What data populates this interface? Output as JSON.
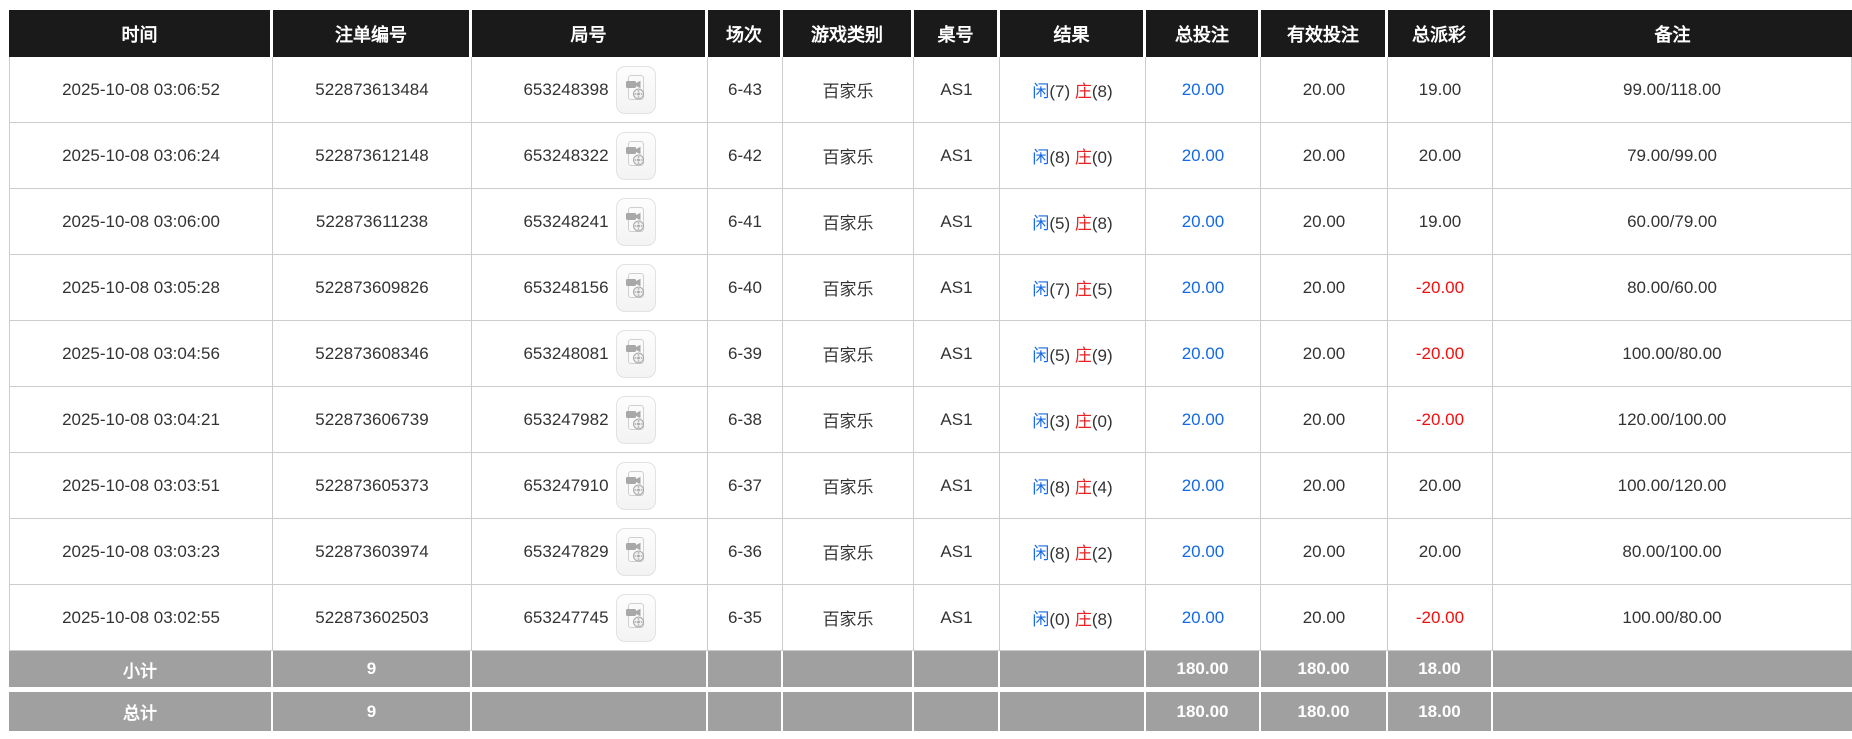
{
  "table": {
    "columns": [
      {
        "key": "time",
        "label": "时间"
      },
      {
        "key": "bet_id",
        "label": "注单编号"
      },
      {
        "key": "round_id",
        "label": "局号"
      },
      {
        "key": "session",
        "label": "场次"
      },
      {
        "key": "game_type",
        "label": "游戏类别"
      },
      {
        "key": "table_no",
        "label": "桌号"
      },
      {
        "key": "result",
        "label": "结果"
      },
      {
        "key": "total_bet",
        "label": "总投注"
      },
      {
        "key": "valid_bet",
        "label": "有效投注"
      },
      {
        "key": "payout",
        "label": "总派彩"
      },
      {
        "key": "remark",
        "label": "备注"
      }
    ],
    "rows": [
      {
        "time": "2025-10-08 03:06:52",
        "bet_id": "522873613484",
        "round_id": "653248398",
        "session": "6-43",
        "game_type": "百家乐",
        "table_no": "AS1",
        "result": {
          "player": "闲",
          "player_pts": "(7)",
          "banker": "庄",
          "banker_pts": "(8)"
        },
        "total_bet": "20.00",
        "valid_bet": "20.00",
        "payout": "19.00",
        "payout_negative": false,
        "remark": "99.00/118.00"
      },
      {
        "time": "2025-10-08 03:06:24",
        "bet_id": "522873612148",
        "round_id": "653248322",
        "session": "6-42",
        "game_type": "百家乐",
        "table_no": "AS1",
        "result": {
          "player": "闲",
          "player_pts": "(8)",
          "banker": "庄",
          "banker_pts": "(0)"
        },
        "total_bet": "20.00",
        "valid_bet": "20.00",
        "payout": "20.00",
        "payout_negative": false,
        "remark": "79.00/99.00"
      },
      {
        "time": "2025-10-08 03:06:00",
        "bet_id": "522873611238",
        "round_id": "653248241",
        "session": "6-41",
        "game_type": "百家乐",
        "table_no": "AS1",
        "result": {
          "player": "闲",
          "player_pts": "(5)",
          "banker": "庄",
          "banker_pts": "(8)"
        },
        "total_bet": "20.00",
        "valid_bet": "20.00",
        "payout": "19.00",
        "payout_negative": false,
        "remark": "60.00/79.00"
      },
      {
        "time": "2025-10-08 03:05:28",
        "bet_id": "522873609826",
        "round_id": "653248156",
        "session": "6-40",
        "game_type": "百家乐",
        "table_no": "AS1",
        "result": {
          "player": "闲",
          "player_pts": "(7)",
          "banker": "庄",
          "banker_pts": "(5)"
        },
        "total_bet": "20.00",
        "valid_bet": "20.00",
        "payout": "-20.00",
        "payout_negative": true,
        "remark": "80.00/60.00"
      },
      {
        "time": "2025-10-08 03:04:56",
        "bet_id": "522873608346",
        "round_id": "653248081",
        "session": "6-39",
        "game_type": "百家乐",
        "table_no": "AS1",
        "result": {
          "player": "闲",
          "player_pts": "(5)",
          "banker": "庄",
          "banker_pts": "(9)"
        },
        "total_bet": "20.00",
        "valid_bet": "20.00",
        "payout": "-20.00",
        "payout_negative": true,
        "remark": "100.00/80.00"
      },
      {
        "time": "2025-10-08 03:04:21",
        "bet_id": "522873606739",
        "round_id": "653247982",
        "session": "6-38",
        "game_type": "百家乐",
        "table_no": "AS1",
        "result": {
          "player": "闲",
          "player_pts": "(3)",
          "banker": "庄",
          "banker_pts": "(0)"
        },
        "total_bet": "20.00",
        "valid_bet": "20.00",
        "payout": "-20.00",
        "payout_negative": true,
        "remark": "120.00/100.00"
      },
      {
        "time": "2025-10-08 03:03:51",
        "bet_id": "522873605373",
        "round_id": "653247910",
        "session": "6-37",
        "game_type": "百家乐",
        "table_no": "AS1",
        "result": {
          "player": "闲",
          "player_pts": "(8)",
          "banker": "庄",
          "banker_pts": "(4)"
        },
        "total_bet": "20.00",
        "valid_bet": "20.00",
        "payout": "20.00",
        "payout_negative": false,
        "remark": "100.00/120.00"
      },
      {
        "time": "2025-10-08 03:03:23",
        "bet_id": "522873603974",
        "round_id": "653247829",
        "session": "6-36",
        "game_type": "百家乐",
        "table_no": "AS1",
        "result": {
          "player": "闲",
          "player_pts": "(8)",
          "banker": "庄",
          "banker_pts": "(2)"
        },
        "total_bet": "20.00",
        "valid_bet": "20.00",
        "payout": "20.00",
        "payout_negative": false,
        "remark": "80.00/100.00"
      },
      {
        "time": "2025-10-08 03:02:55",
        "bet_id": "522873602503",
        "round_id": "653247745",
        "session": "6-35",
        "game_type": "百家乐",
        "table_no": "AS1",
        "result": {
          "player": "闲",
          "player_pts": "(0)",
          "banker": "庄",
          "banker_pts": "(8)"
        },
        "total_bet": "20.00",
        "valid_bet": "20.00",
        "payout": "-20.00",
        "payout_negative": true,
        "remark": "100.00/80.00"
      }
    ],
    "footer": [
      {
        "label": "小计",
        "count": "9",
        "total_bet": "180.00",
        "valid_bet": "180.00",
        "payout": "18.00"
      },
      {
        "label": "总计",
        "count": "9",
        "total_bet": "180.00",
        "valid_bet": "180.00",
        "payout": "18.00"
      }
    ]
  },
  "icons": {
    "round_video": "video-replay-icon"
  },
  "colors": {
    "header_bg": "#1a1a1a",
    "footer_bg": "#a0a0a0",
    "link_blue": "#1569e6",
    "banker_red": "#e62222",
    "negative_red": "#f50d0d",
    "text": "#333333"
  }
}
